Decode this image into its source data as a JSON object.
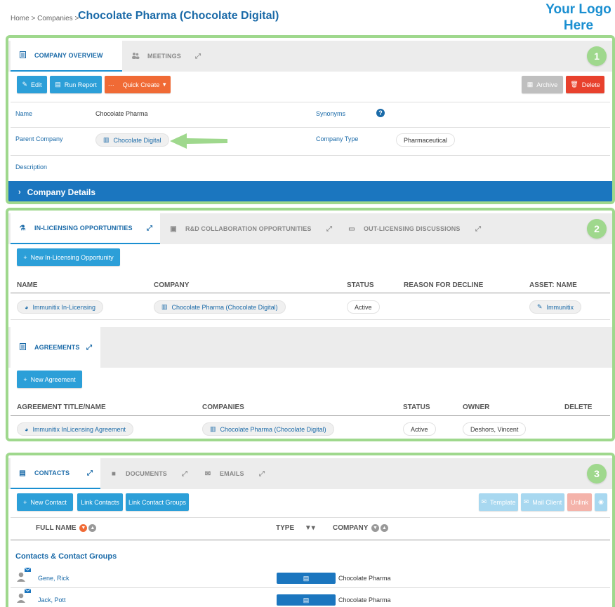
{
  "breadcrumb": {
    "home": "Home",
    "sep": " > ",
    "companies": "Companies",
    "sep2": " > "
  },
  "page_title": "Chocolate Pharma (Chocolate Digital)",
  "logo": {
    "line1": "Your Logo",
    "line2": "Here"
  },
  "overview": {
    "callout": "1",
    "tabs": {
      "overview": "COMPANY OVERVIEW",
      "meetings": "MEETINGS"
    },
    "buttons": {
      "edit": "Edit",
      "run_report": "Run Report",
      "quick_create": "Quick Create",
      "archive": "Archive",
      "delete": "Delete"
    },
    "fields": {
      "name_label": "Name",
      "name_value": "Chocolate Pharma",
      "synonyms_label": "Synonyms",
      "synonyms_help": "?",
      "parent_label": "Parent Company",
      "parent_value": "Chocolate Digital",
      "type_label": "Company Type",
      "type_value": "Pharmaceutical",
      "description_label": "Description"
    },
    "details_bar": "Company Details"
  },
  "opportunities": {
    "callout": "2",
    "tabs": {
      "inlicensing": "IN-LICENSING OPPORTUNITIES",
      "rnd": "R&D COLLABORATION OPPORTUNITIES",
      "outlicensing": "OUT-LICENSING DISCUSSIONS"
    },
    "new_button": "New In-Licensing Opportunity",
    "headers": {
      "name": "NAME",
      "company": "COMPANY",
      "status": "STATUS",
      "reason": "REASON FOR DECLINE",
      "asset": "ASSET: NAME"
    },
    "row": {
      "name": "Immunitix In-Licensing",
      "company": "Chocolate Pharma (Chocolate Digital)",
      "status": "Active",
      "asset": "Immunitix"
    },
    "agreements": {
      "tab": "AGREEMENTS",
      "new_button": "New Agreement",
      "headers": {
        "title": "AGREEMENT TITLE/NAME",
        "companies": "COMPANIES",
        "status": "STATUS",
        "owner": "OWNER",
        "delete": "DELETE"
      },
      "row": {
        "title": "Immunitix InLicensing Agreement",
        "companies": "Chocolate Pharma (Chocolate Digital)",
        "status": "Active",
        "owner": "Deshors, Vincent"
      }
    }
  },
  "contacts": {
    "callout": "3",
    "tabs": {
      "contacts": "CONTACTS",
      "documents": "DOCUMENTS",
      "emails": "EMAILS"
    },
    "buttons": {
      "new_contact": "New Contact",
      "link_contacts": "Link Contacts",
      "link_groups": "Link Contact Groups",
      "template": "Template",
      "mail_client": "Mail Client",
      "unlink": "Unlink"
    },
    "headers": {
      "full_name": "FULL NAME",
      "type": "TYPE",
      "company": "COMPANY"
    },
    "section_title": "Contacts & Contact Groups",
    "rows": [
      {
        "name": "Gene, Rick",
        "company": "Chocolate Pharma"
      },
      {
        "name": "Jack, Pott",
        "company": "Chocolate Pharma"
      }
    ]
  },
  "colors": {
    "accent": "#1a6aa8",
    "button_blue": "#2c9fd8",
    "orange": "#f06a35",
    "red": "#e8412d",
    "highlight_green": "#9fd88d",
    "bar_blue": "#1b76bf"
  }
}
